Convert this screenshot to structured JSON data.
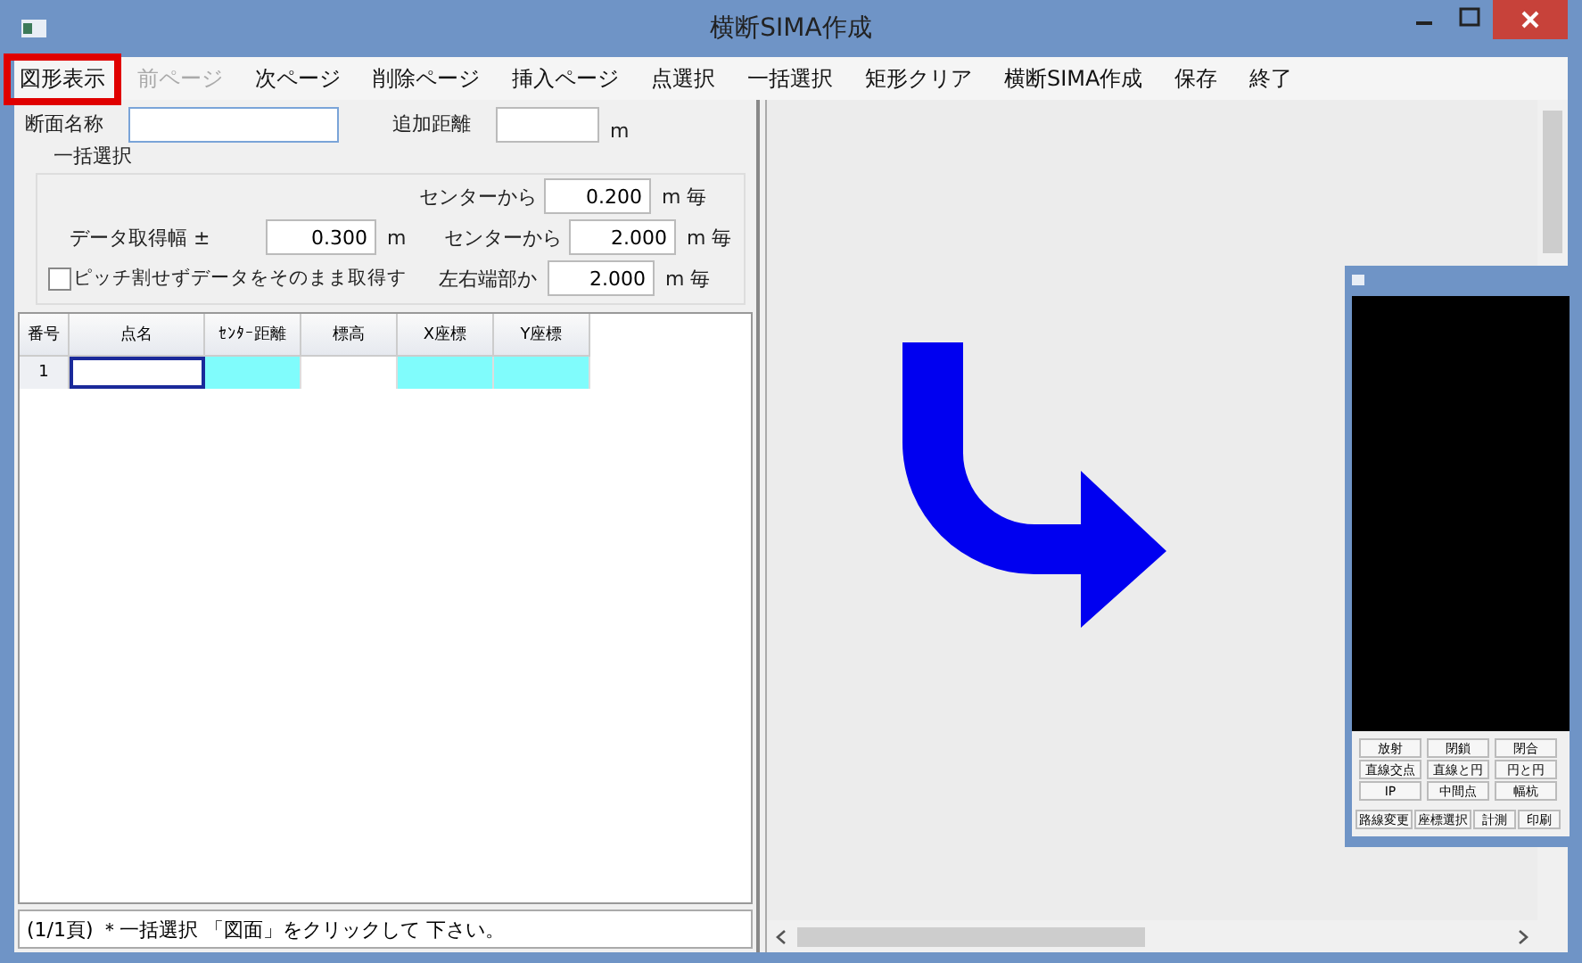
{
  "window": {
    "title": "横断SIMA作成"
  },
  "menu": [
    {
      "label": "図形表示",
      "disabled": false,
      "highlighted": true
    },
    {
      "label": "前ページ",
      "disabled": true,
      "highlighted": false
    },
    {
      "label": "次ページ",
      "disabled": false,
      "highlighted": false
    },
    {
      "label": "削除ページ",
      "disabled": false,
      "highlighted": false
    },
    {
      "label": "挿入ページ",
      "disabled": false,
      "highlighted": false
    },
    {
      "label": "点選択",
      "disabled": false,
      "highlighted": false
    },
    {
      "label": "一括選択",
      "disabled": false,
      "highlighted": false
    },
    {
      "label": "矩形クリア",
      "disabled": false,
      "highlighted": false
    },
    {
      "label": "横断SIMA作成",
      "disabled": false,
      "highlighted": false
    },
    {
      "label": "保存",
      "disabled": false,
      "highlighted": false
    },
    {
      "label": "終了",
      "disabled": false,
      "highlighted": false
    }
  ],
  "form": {
    "section_name": {
      "label": "断面名称"
    },
    "added_distance": {
      "label": "追加距離",
      "unit": "m"
    },
    "group_title": "一括選択",
    "data_width": {
      "label": "データ取得幅 ±",
      "value": "0.300",
      "unit": "m"
    },
    "pitch_rows": [
      {
        "label": "センターから",
        "value": "0.200",
        "unit": "m 毎"
      },
      {
        "label": "センターから",
        "value": "2.000",
        "unit": "m 毎"
      },
      {
        "label": "左右端部か",
        "value": "2.000",
        "unit": "m 毎"
      }
    ],
    "checkbox": {
      "label": "ピッチ割せずデータをそのまま取得す",
      "checked": false
    }
  },
  "table": {
    "columns": [
      "番号",
      "点名",
      "ｾﾝﾀｰ距離",
      "標高",
      "X座標",
      "Y座標"
    ],
    "rows": [
      {
        "number": "1",
        "cells": [
          {
            "kind": "editing"
          },
          {
            "kind": "computed"
          },
          {
            "kind": "input"
          },
          {
            "kind": "computed"
          },
          {
            "kind": "computed"
          }
        ]
      }
    ]
  },
  "status": "(1/1頁) ＊一括選択 「図面」をクリックして 下さい。",
  "sub_window": {
    "button_rows": [
      [
        "放射",
        "閉鎖",
        "閉合"
      ],
      [
        "直線交点",
        "直線と円",
        "円と円"
      ],
      [
        "IP",
        "中間点",
        "幅杭"
      ]
    ],
    "bottom_buttons": [
      "路線変更",
      "座標選択",
      "計測",
      "印刷"
    ]
  }
}
